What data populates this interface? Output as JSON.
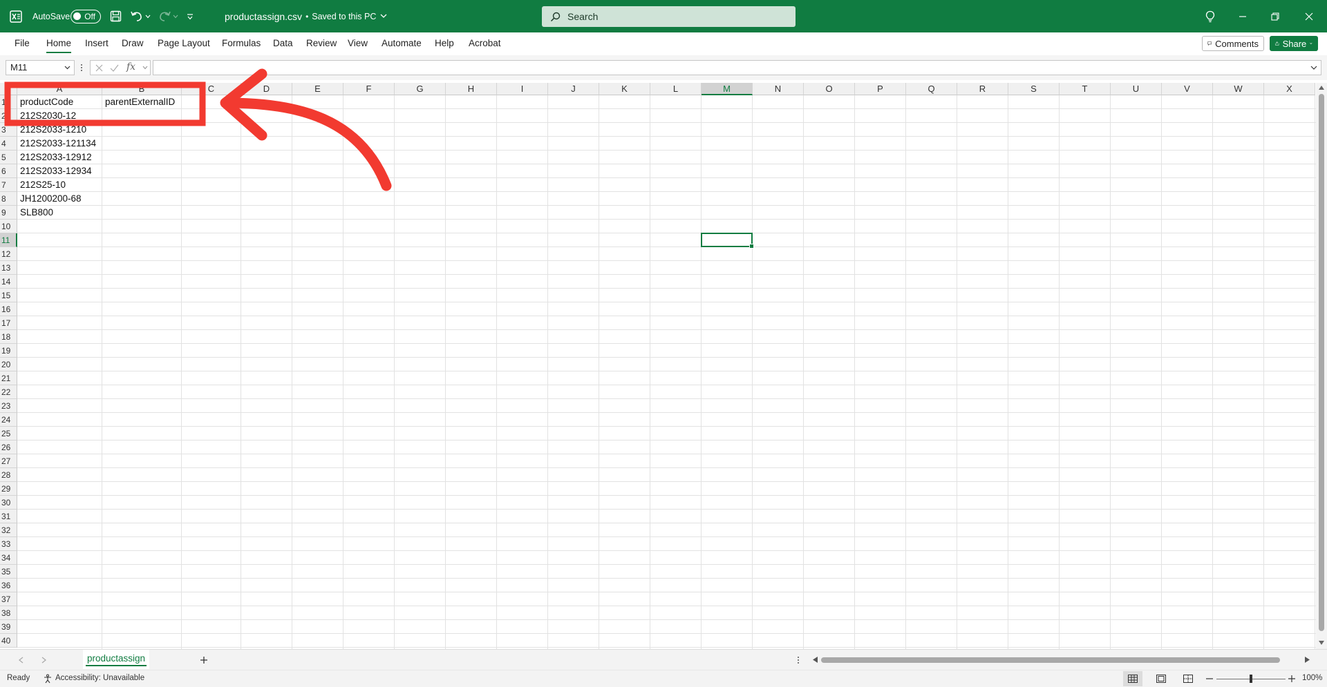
{
  "window": {
    "autosave_label": "AutoSave",
    "autosave_state": "Off",
    "file_title": "productassign.csv",
    "save_status": "Saved to this PC",
    "search_placeholder": "Search"
  },
  "ribbon": {
    "tabs": [
      "File",
      "Home",
      "Insert",
      "Draw",
      "Page Layout",
      "Formulas",
      "Data",
      "Review",
      "View",
      "Automate",
      "Help",
      "Acrobat"
    ],
    "active_tab": "Home",
    "comments_label": "Comments",
    "share_label": "Share"
  },
  "formula_bar": {
    "name_box": "M11",
    "fx_label": "fx",
    "formula": ""
  },
  "sheet": {
    "columns": [
      "A",
      "B",
      "C",
      "D",
      "E",
      "F",
      "G",
      "H",
      "I",
      "J",
      "K",
      "L",
      "M",
      "N",
      "O",
      "P",
      "Q",
      "R",
      "S",
      "T",
      "U",
      "V",
      "W",
      "X"
    ],
    "row_numbers": [
      1,
      2,
      3,
      4,
      5,
      6,
      7,
      8,
      9,
      10,
      11,
      12,
      13,
      14,
      15,
      16,
      17,
      18,
      19,
      20,
      21,
      22,
      23,
      24,
      25,
      26,
      27,
      28,
      29,
      30,
      31,
      32,
      33,
      34,
      35,
      36,
      37,
      38,
      39,
      40
    ],
    "selected_column": "M",
    "selected_row": 11,
    "cells": [
      {
        "ref": "A1",
        "value": "productCode"
      },
      {
        "ref": "B1",
        "value": "parentExternalID"
      },
      {
        "ref": "A2",
        "value": "212S2030-12"
      },
      {
        "ref": "A3",
        "value": "212S2033-1210"
      },
      {
        "ref": "A4",
        "value": "212S2033-121134"
      },
      {
        "ref": "A5",
        "value": "212S2033-12912"
      },
      {
        "ref": "A6",
        "value": "212S2033-12934"
      },
      {
        "ref": "A7",
        "value": "212S25-10"
      },
      {
        "ref": "A8",
        "value": "JH1200200-68"
      },
      {
        "ref": "A9",
        "value": "SLB800"
      }
    ]
  },
  "sheet_tabs": {
    "active": "productassign"
  },
  "status": {
    "ready": "Ready",
    "accessibility": "Accessibility: Unavailable",
    "zoom": "100%"
  },
  "colors": {
    "excel_green": "#107c41",
    "annotation_red": "#f23a30"
  }
}
